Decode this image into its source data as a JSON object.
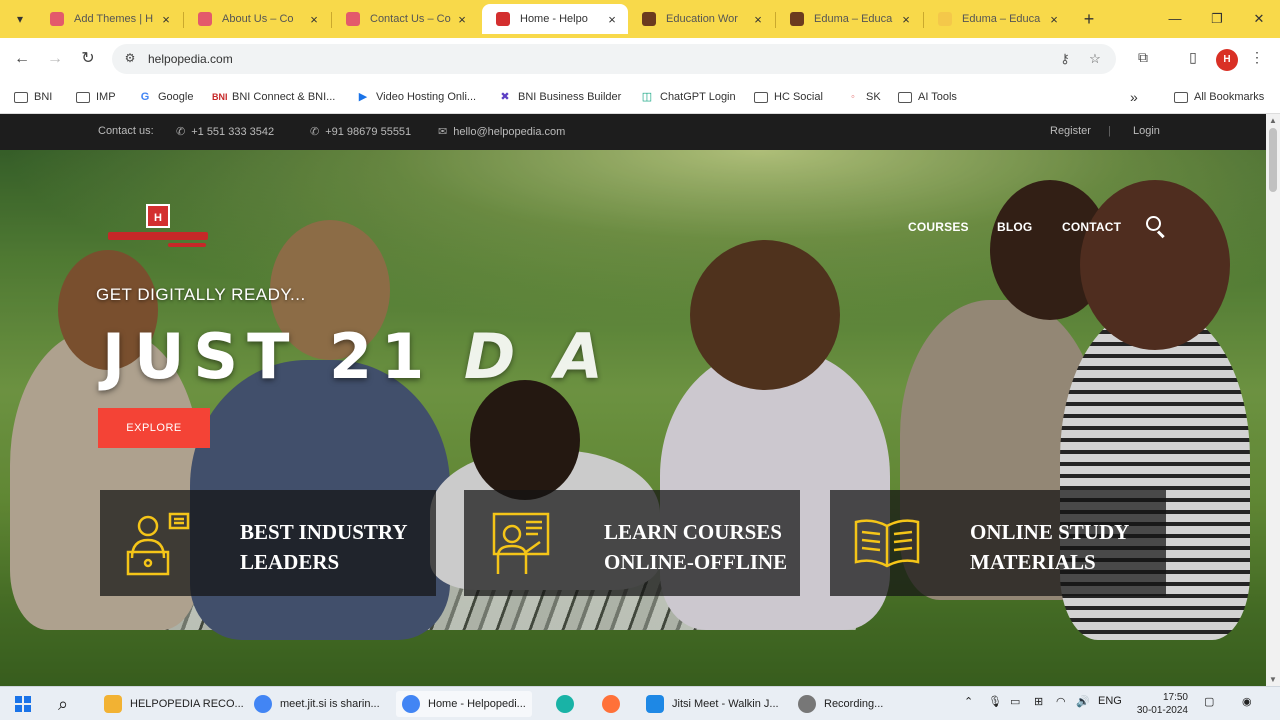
{
  "browser": {
    "tabs": [
      {
        "label": "Add Themes | H",
        "favicon_color": "#e35a6b",
        "active": false
      },
      {
        "label": "About Us – Co",
        "favicon_color": "#e35a6b",
        "active": false
      },
      {
        "label": "Contact Us – Co",
        "favicon_color": "#e35a6b",
        "active": false
      },
      {
        "label": "Home - Helpo",
        "favicon_color": "#d32f2f",
        "active": true
      },
      {
        "label": "Education Wor",
        "favicon_color": "#6b3b1f",
        "active": false
      },
      {
        "label": "Eduma – Educa",
        "favicon_color": "#6b3b1f",
        "active": false
      },
      {
        "label": "Eduma – Educa",
        "favicon_color": "#f4c84a",
        "active": false
      }
    ],
    "close_glyph": "×",
    "new_tab_glyph": "+",
    "url": "helpopedia.com",
    "bookmarks": [
      {
        "label": "BNI",
        "icon": "folder-icon"
      },
      {
        "label": "IMP",
        "icon": "folder-icon"
      },
      {
        "label": "Google",
        "icon": "google-icon"
      },
      {
        "label": "BNI Connect & BNI...",
        "icon": "bni-icon"
      },
      {
        "label": "Video Hosting Onli...",
        "icon": "video-icon"
      },
      {
        "label": "BNI Business Builder",
        "icon": "bni-builder-icon"
      },
      {
        "label": "ChatGPT Login",
        "icon": "chatgpt-icon"
      },
      {
        "label": "HC Social",
        "icon": "folder-icon"
      },
      {
        "label": "SK",
        "icon": "sk-icon"
      },
      {
        "label": "AI Tools",
        "icon": "folder-icon"
      }
    ],
    "bookmarks_overflow": "»",
    "all_bookmarks": "All Bookmarks"
  },
  "site": {
    "topbar": {
      "contact_label": "Contact us:",
      "phone1": "+1 551 333 3542",
      "phone2": "+91 98679 55551",
      "email": "hello@helpopedia.com",
      "register": "Register",
      "login": "Login"
    },
    "logo_mark": "H",
    "menu": [
      "COURSES",
      "BLOG",
      "CONTACT"
    ],
    "tagline": "GET DIGITALLY READY...",
    "headline_solid": "JUST 21",
    "headline_faded": "D A",
    "explore_label": "EXPLORE",
    "features": [
      {
        "line1": "BEST INDUSTRY",
        "line2": "LEADERS",
        "icon": "expert-icon"
      },
      {
        "line1": "LEARN COURSES",
        "line2": "ONLINE-OFFLINE",
        "icon": "teacher-board-icon"
      },
      {
        "line1": "ONLINE STUDY",
        "line2": "MATERIALS",
        "icon": "open-book-icon"
      }
    ],
    "accent_color": "#f44336",
    "icon_color": "#f5c518"
  },
  "taskbar": {
    "items": [
      {
        "label": "HELPOPEDIA RECO...",
        "icon_color": "#f2b233"
      },
      {
        "label": "meet.jit.si is sharin...",
        "icon_color": "#4285f4"
      },
      {
        "label": "Home - Helpopedi...",
        "icon_color": "#4285f4"
      },
      {
        "label": "Jitsi Meet - Walkin J...",
        "icon_color": "#1e88e5"
      },
      {
        "label": "Recording...",
        "icon_color": "#777777"
      }
    ],
    "lang": "ENG",
    "time": "17:50",
    "date": "30-01-2024"
  }
}
